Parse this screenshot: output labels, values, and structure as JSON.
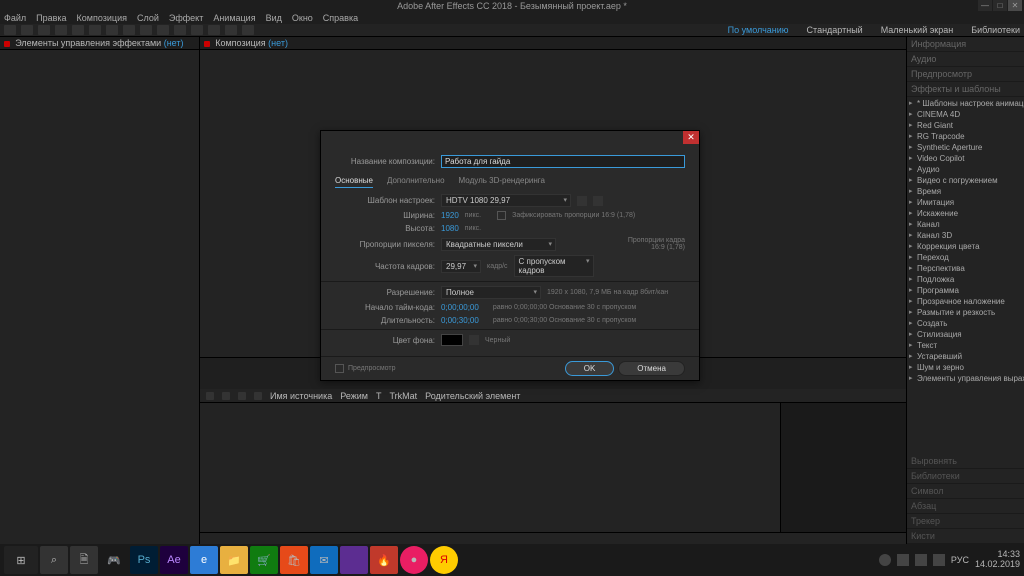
{
  "title": "Adobe After Effects CC 2018 - Безымянный проект.aep *",
  "menu": [
    "Файл",
    "Правка",
    "Композиция",
    "Слой",
    "Эффект",
    "Анимация",
    "Вид",
    "Окно",
    "Справка"
  ],
  "workspaces": {
    "items": [
      "По умолчанию",
      "Стандартный",
      "Маленький экран",
      "Библиотеки"
    ],
    "activeIndex": 0
  },
  "winbtns": {
    "min": "—",
    "max": "□",
    "close": "✕"
  },
  "left_panel": {
    "tab_prefix": "Элементы управления эффектами ",
    "tab_suffix": "(нет)"
  },
  "viewer": {
    "tab_prefix": "Композиция ",
    "tab_suffix": "(нет)"
  },
  "timeline": {
    "cols": [
      "Имя источника",
      "Режим",
      "T",
      "TrkMat",
      "Родительский элемент"
    ]
  },
  "right": {
    "top_sections": [
      "Информация",
      "Аудио",
      "Предпросмотр",
      "Эффекты и шаблоны"
    ],
    "effects": [
      "* Шаблоны настроек анимации",
      "CINEMA 4D",
      "Red Giant",
      "RG Trapcode",
      "Synthetic Aperture",
      "Video Copilot",
      "Аудио",
      "Видео с погружением",
      "Время",
      "Имитация",
      "Искажение",
      "Канал",
      "Канал 3D",
      "Коррекция цвета",
      "Переход",
      "Перспектива",
      "Подложка",
      "Программа",
      "Прозрачное наложение",
      "Размытие и резкость",
      "Создать",
      "Стилизация",
      "Текст",
      "Устаревший",
      "Шум и зерно",
      "Элементы управления выражения"
    ],
    "bottom_sections": [
      "Выровнять",
      "Библиотеки",
      "Символ",
      "Абзац",
      "Трекер",
      "Кисти"
    ]
  },
  "dialog": {
    "name_label": "Название композиции:",
    "name_value": "Работа для гайда",
    "tabs": [
      "Основные",
      "Дополнительно",
      "Модуль 3D-рендеринга"
    ],
    "preset_label": "Шаблон настроек:",
    "preset_value": "HDTV 1080 29,97",
    "width_label": "Ширина:",
    "width_value": "1920",
    "height_label": "Высота:",
    "height_value": "1080",
    "px": "пикс.",
    "lock_aspect": "Зафиксировать пропорции 16:9 (1,78)",
    "pixel_aspect_label": "Пропорции пикселя:",
    "pixel_aspect_value": "Квадратные пиксели",
    "frame_aspect_label": "Пропорции кадра",
    "frame_aspect_value": "16:9 (1,78)",
    "fps_label": "Частота кадров:",
    "fps_value": "29,97",
    "fps_unit": "кадр/с",
    "drop_value": "С пропуском кадров",
    "res_label": "Разрешение:",
    "res_value": "Полное",
    "res_info": "1920 x 1080, 7,9 МБ на кадр 8бит/кан",
    "tc_start_label": "Начало тайм-кода:",
    "tc_start_value": "0;00;00;00",
    "tc_start_info": "равно 0;00;00;00 Основание 30 с пропуском",
    "duration_label": "Длительность:",
    "duration_value": "0;00;30;00",
    "duration_info": "равно 0;00;30;00 Основание 30 с пропуском",
    "bg_label": "Цвет фона:",
    "bg_name": "Черный",
    "preview": "Предпросмотр",
    "ok": "OK",
    "cancel": "Отмена"
  },
  "taskbar": {
    "icons": [
      "⊞",
      "⌕",
      "🗎",
      "🌐",
      "🎮",
      "Ps",
      "Ae",
      "e",
      "📁",
      "🛒",
      "🛍",
      "✉",
      "🔥",
      "●",
      "●",
      "Я"
    ],
    "tray": [
      "РУС"
    ],
    "time": "14:33",
    "date": "14.02.2019"
  }
}
